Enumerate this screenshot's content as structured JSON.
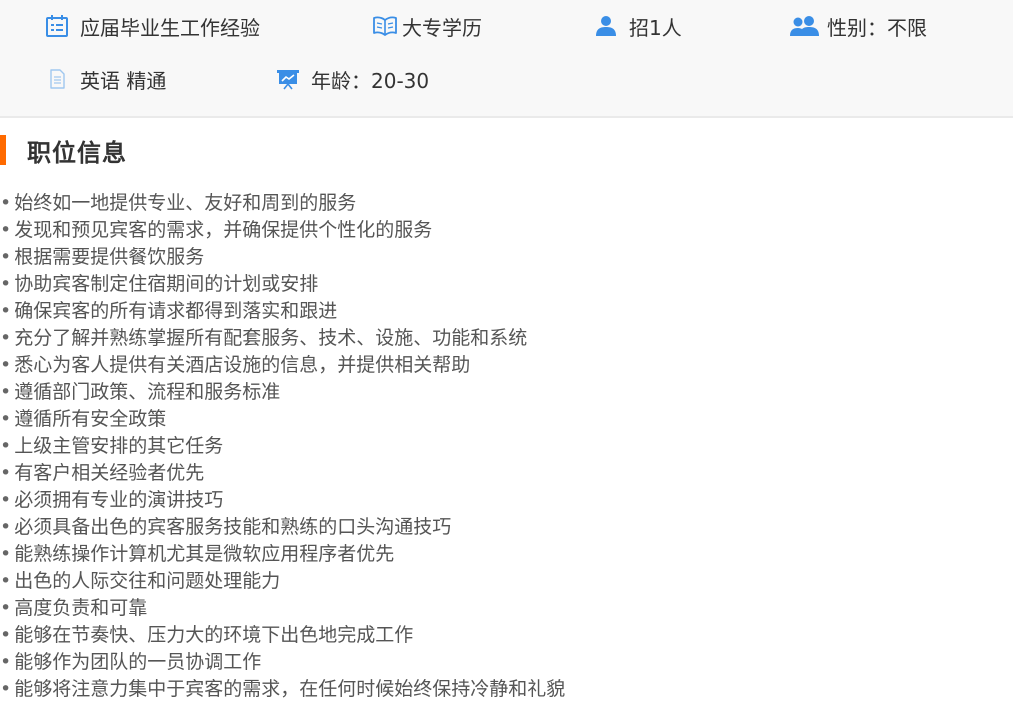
{
  "job_attributes": {
    "experience": "应届毕业生工作经验",
    "education": "大专学历",
    "headcount": "招1人",
    "gender": "性别：不限",
    "language": "英语 精通",
    "age": "年龄：20-30"
  },
  "section": {
    "title": "职位信息"
  },
  "duties": [
    "始终如一地提供专业、友好和周到的服务",
    "发现和预见宾客的需求，并确保提供个性化的服务",
    "根据需要提供餐饮服务",
    "协助宾客制定住宿期间的计划或安排",
    "确保宾客的所有请求都得到落实和跟进",
    "充分了解并熟练掌握所有配套服务、技术、设施、功能和系统",
    "悉心为客人提供有关酒店设施的信息，并提供相关帮助",
    "遵循部门政策、流程和服务标准",
    "遵循所有安全政策",
    "上级主管安排的其它任务",
    "有客户相关经验者优先",
    "必须拥有专业的演讲技巧",
    "必须具备出色的宾客服务技能和熟练的口头沟通技巧",
    "能熟练操作计算机尤其是微软应用程序者优先",
    "出色的人际交往和问题处理能力",
    "高度负责和可靠",
    "能够在节奏快、压力大的环境下出色地完成工作",
    "能够作为团队的一员协调工作",
    "能够将注意力集中于宾客的需求，在任何时候始终保持冷静和礼貌"
  ],
  "icons": {
    "experience": "calendar-list-icon",
    "education": "open-book-icon",
    "headcount": "person-icon",
    "gender": "people-icon",
    "language": "document-icon",
    "age": "presentation-board-icon"
  },
  "colors": {
    "icon_blue": "#3a8ee6",
    "accent_orange": "#ff6a00",
    "panel_bg": "#f8f8f8"
  }
}
